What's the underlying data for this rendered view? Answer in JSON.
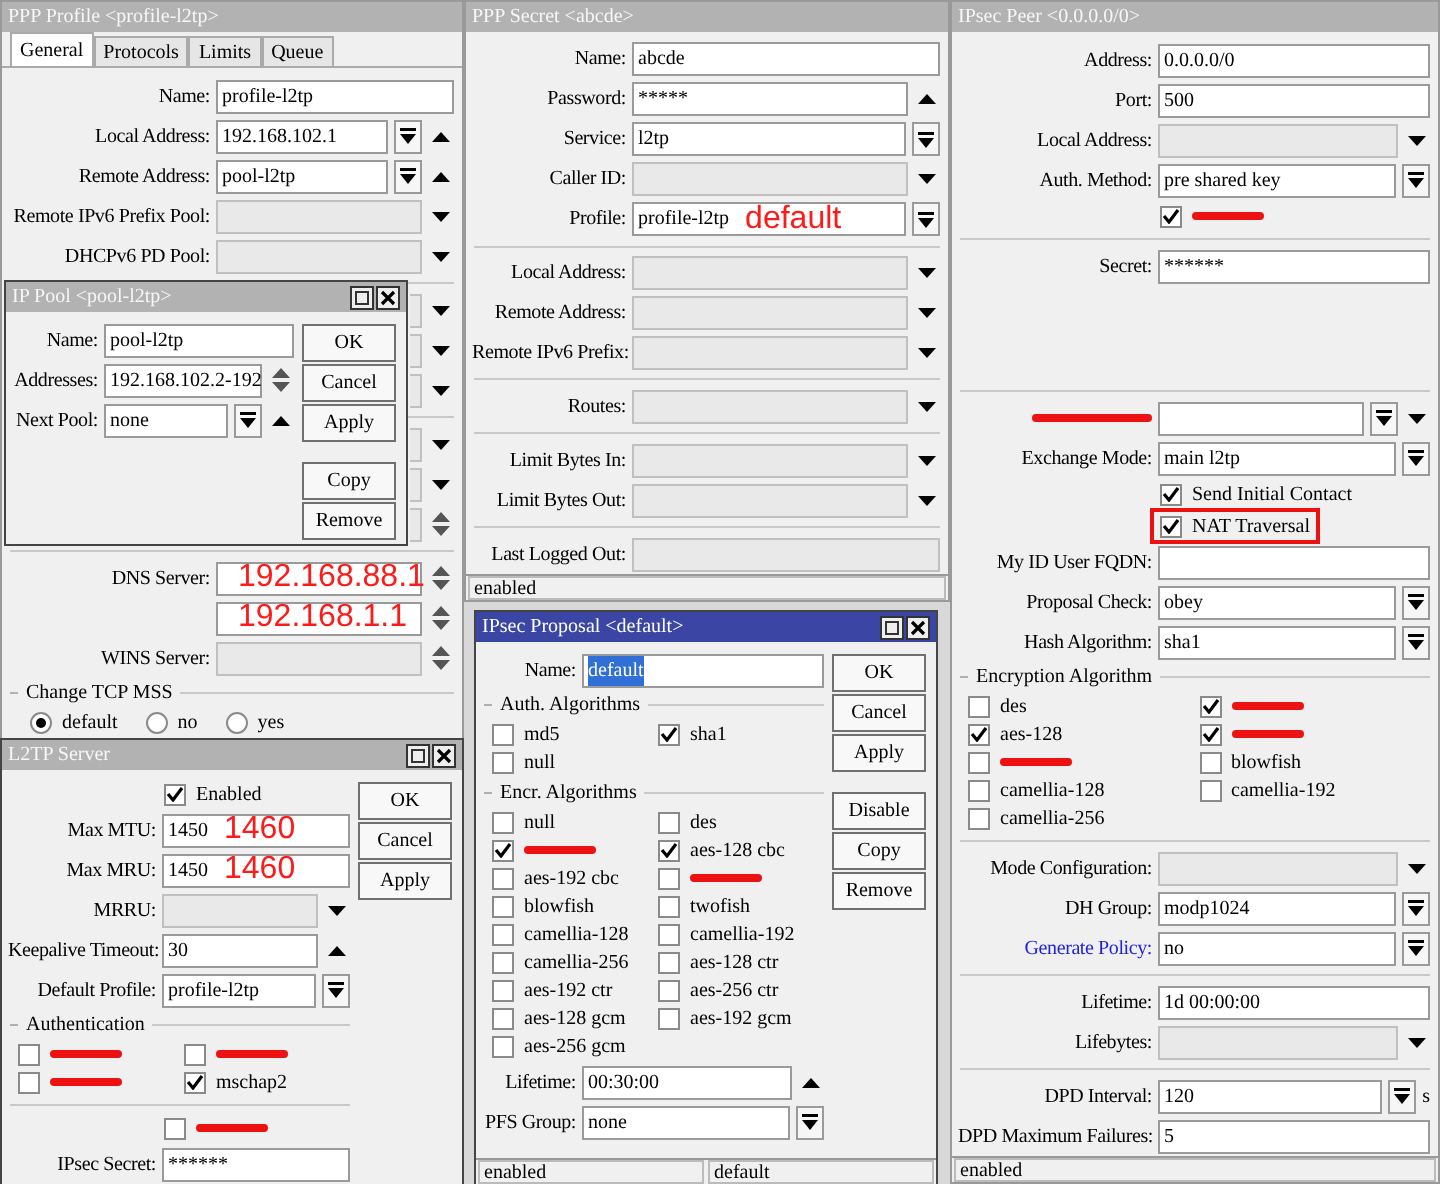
{
  "windows": [
    {
      "title": "PPP Profile <profile-l2tp>",
      "active": false,
      "tabs": [
        {
          "label": "General",
          "selected": true
        },
        {
          "label": "Protocols",
          "selected": false
        },
        {
          "label": "Limits",
          "selected": false
        },
        {
          "label": "Queue",
          "selected": false
        }
      ],
      "rows": [
        {
          "kind": "field",
          "label": "Name:",
          "value": "profile-l2tp",
          "disabled": false
        },
        {
          "kind": "field",
          "label": "Local Address:",
          "value": "192.168.102.1",
          "disabled": false,
          "controls": [
            {
              "kind": "combo"
            },
            {
              "kind": "up"
            }
          ]
        },
        {
          "kind": "field",
          "label": "Remote Address:",
          "value": "pool-l2tp",
          "disabled": false,
          "controls": [
            {
              "kind": "combo"
            },
            {
              "kind": "up"
            }
          ]
        },
        {
          "kind": "field",
          "label": "Remote IPv6 Prefix Pool:",
          "disabled": true,
          "controls": [
            {
              "kind": "down"
            }
          ]
        },
        {
          "kind": "field",
          "label": "DHCPv6 PD Pool:",
          "disabled": true,
          "controls": [
            {
              "kind": "down"
            }
          ]
        },
        {
          "kind": "divider"
        },
        {
          "kind": "stub",
          "controls": [
            {
              "kind": "down"
            }
          ]
        },
        {
          "kind": "stub",
          "controls": [
            {
              "kind": "down"
            }
          ]
        },
        {
          "kind": "stub",
          "controls": [
            {
              "kind": "down"
            }
          ]
        },
        {
          "kind": "divider"
        },
        {
          "kind": "stub",
          "controls": [
            {
              "kind": "down"
            }
          ]
        },
        {
          "kind": "stub",
          "controls": [
            {
              "kind": "down"
            }
          ]
        },
        {
          "kind": "stub",
          "controls": [
            {
              "kind": "updown"
            }
          ]
        },
        {
          "kind": "divider"
        },
        {
          "kind": "field",
          "label": "DNS Server:",
          "disabled": false,
          "note": "192.168.88.1",
          "controls": [
            {
              "kind": "updown"
            }
          ]
        },
        {
          "kind": "field",
          "disabled": false,
          "note": "192.168.1.1",
          "controls": [
            {
              "kind": "updown"
            }
          ]
        },
        {
          "kind": "field",
          "label": "WINS Server:",
          "disabled": true,
          "controls": [
            {
              "kind": "updown"
            }
          ]
        },
        {
          "kind": "section",
          "label": "Change TCP MSS"
        },
        {
          "kind": "radios",
          "options": [
            {
              "label": "default",
              "selected": true
            },
            {
              "label": "no",
              "selected": false
            },
            {
              "label": "yes",
              "selected": false
            }
          ]
        }
      ]
    },
    {
      "title": "IP Pool <pool-l2tp>",
      "active": false,
      "window_buttons": true,
      "rows": [
        {
          "kind": "field",
          "label": "Name:",
          "value": "pool-l2tp",
          "disabled": false
        },
        {
          "kind": "field",
          "label": "Addresses:",
          "value": "192.168.102.2-192",
          "disabled": false,
          "controls": [
            {
              "kind": "updown"
            }
          ]
        },
        {
          "kind": "field",
          "label": "Next Pool:",
          "value": "none",
          "disabled": false,
          "controls": [
            {
              "kind": "combo"
            },
            {
              "kind": "up"
            }
          ]
        }
      ],
      "buttons": [
        [
          "OK",
          "Cancel",
          "Apply"
        ],
        [
          "Copy",
          "Remove"
        ]
      ]
    },
    {
      "title": "L2TP Server",
      "active": false,
      "window_buttons": true,
      "rows": [
        {
          "kind": "check",
          "label": "Enabled",
          "checked": true
        },
        {
          "kind": "field",
          "label": "Max MTU:",
          "value": "1450",
          "note": "1460",
          "disabled": false
        },
        {
          "kind": "field",
          "label": "Max MRU:",
          "value": "1450",
          "note": "1460",
          "disabled": false
        },
        {
          "kind": "field",
          "label": "MRRU:",
          "disabled": true,
          "controls": [
            {
              "kind": "down"
            }
          ]
        },
        {
          "kind": "field",
          "label": "Keepalive Timeout:",
          "value": "30",
          "disabled": false,
          "controls": [
            {
              "kind": "up"
            }
          ]
        },
        {
          "kind": "field",
          "label": "Default Profile:",
          "value": "profile-l2tp",
          "disabled": false,
          "controls": [
            {
              "kind": "combo"
            }
          ]
        },
        {
          "kind": "section",
          "label": "Authentication"
        },
        {
          "kind": "checkgrid",
          "items": [
            {
              "checked": false,
              "redacted": true
            },
            {
              "checked": false,
              "redacted": true
            },
            {
              "checked": false,
              "redacted": true
            },
            {
              "label": "mschap2",
              "checked": true,
              "redacted": false
            }
          ]
        },
        {
          "kind": "divider"
        },
        {
          "kind": "check",
          "checked": false,
          "redacted": true
        },
        {
          "kind": "field",
          "label": "IPsec Secret:",
          "value": "******",
          "disabled": false
        }
      ],
      "buttons": [
        [
          "OK",
          "Cancel",
          "Apply"
        ]
      ]
    },
    {
      "title": "PPP Secret <abcde>",
      "active": false,
      "rows": [
        {
          "kind": "field",
          "label": "Name:",
          "value": "abcde",
          "disabled": false
        },
        {
          "kind": "field",
          "label": "Password:",
          "value": "*****",
          "disabled": false,
          "controls": [
            {
              "kind": "up"
            }
          ]
        },
        {
          "kind": "field",
          "label": "Service:",
          "value": "l2tp",
          "disabled": false,
          "controls": [
            {
              "kind": "combo"
            }
          ]
        },
        {
          "kind": "field",
          "label": "Caller ID:",
          "disabled": true,
          "controls": [
            {
              "kind": "down"
            }
          ]
        },
        {
          "kind": "field",
          "label": "Profile:",
          "value": "profile-l2tp",
          "note": "default",
          "disabled": false,
          "controls": [
            {
              "kind": "combo"
            }
          ]
        },
        {
          "kind": "divider"
        },
        {
          "kind": "field",
          "label": "Local Address:",
          "disabled": true,
          "controls": [
            {
              "kind": "down"
            }
          ]
        },
        {
          "kind": "field",
          "label": "Remote Address:",
          "disabled": true,
          "controls": [
            {
              "kind": "down"
            }
          ]
        },
        {
          "kind": "field",
          "label": "Remote IPv6 Prefix:",
          "disabled": true,
          "controls": [
            {
              "kind": "down"
            }
          ]
        },
        {
          "kind": "divider"
        },
        {
          "kind": "field",
          "label": "Routes:",
          "disabled": true,
          "controls": [
            {
              "kind": "down"
            }
          ]
        },
        {
          "kind": "divider"
        },
        {
          "kind": "field",
          "label": "Limit Bytes In:",
          "disabled": true,
          "controls": [
            {
              "kind": "down"
            }
          ]
        },
        {
          "kind": "field",
          "label": "Limit Bytes Out:",
          "disabled": true,
          "controls": [
            {
              "kind": "down"
            }
          ]
        },
        {
          "kind": "divider"
        },
        {
          "kind": "field",
          "label": "Last Logged Out:",
          "disabled": true
        }
      ],
      "status": [
        "enabled"
      ]
    },
    {
      "title": "IPsec Proposal <default>",
      "active": true,
      "window_buttons": true,
      "rows": [
        {
          "kind": "field",
          "label": "Name:",
          "value": "default",
          "highlighted": true,
          "disabled": false
        },
        {
          "kind": "section",
          "label": "Auth. Algorithms"
        },
        {
          "kind": "checkgrid",
          "items": [
            {
              "label": "md5",
              "checked": false,
              "redacted": false
            },
            {
              "label": "sha1",
              "checked": true,
              "redacted": false
            },
            {
              "label": "null",
              "checked": false,
              "redacted": false
            }
          ]
        },
        {
          "kind": "section",
          "label": "Encr. Algorithms"
        },
        {
          "kind": "checkgrid",
          "items": [
            {
              "label": "null",
              "checked": false,
              "redacted": false
            },
            {
              "label": "des",
              "checked": false,
              "redacted": false
            },
            {
              "checked": true,
              "redacted": true
            },
            {
              "label": "aes-128 cbc",
              "checked": true,
              "redacted": false
            },
            {
              "label": "aes-192 cbc",
              "checked": false,
              "redacted": false
            },
            {
              "checked": false,
              "redacted": true
            },
            {
              "label": "blowfish",
              "checked": false,
              "redacted": false
            },
            {
              "label": "twofish",
              "checked": false,
              "redacted": false
            },
            {
              "label": "camellia-128",
              "checked": false,
              "redacted": false
            },
            {
              "label": "camellia-192",
              "checked": false,
              "redacted": false
            },
            {
              "label": "camellia-256",
              "checked": false,
              "redacted": false
            },
            {
              "label": "aes-128 ctr",
              "checked": false,
              "redacted": false
            },
            {
              "label": "aes-192 ctr",
              "checked": false,
              "redacted": false
            },
            {
              "label": "aes-256 ctr",
              "checked": false,
              "redacted": false
            },
            {
              "label": "aes-128 gcm",
              "checked": false,
              "redacted": false
            },
            {
              "label": "aes-192 gcm",
              "checked": false,
              "redacted": false
            },
            {
              "label": "aes-256 gcm",
              "checked": false,
              "redacted": false
            }
          ]
        },
        {
          "kind": "field",
          "label": "Lifetime:",
          "value": "00:30:00",
          "disabled": false,
          "controls": [
            {
              "kind": "up"
            }
          ]
        },
        {
          "kind": "field",
          "label": "PFS Group:",
          "value": "none",
          "disabled": false,
          "controls": [
            {
              "kind": "combo"
            }
          ]
        }
      ],
      "buttons": [
        [
          "OK",
          "Cancel",
          "Apply"
        ],
        [
          "Disable",
          "Copy",
          "Remove"
        ]
      ],
      "status": [
        "enabled",
        "default"
      ]
    },
    {
      "title": "IPsec Peer <0.0.0.0/0>",
      "active": false,
      "rows": [
        {
          "kind": "field",
          "label": "Address:",
          "value": "0.0.0.0/0",
          "disabled": false
        },
        {
          "kind": "field",
          "label": "Port:",
          "value": "500",
          "disabled": false
        },
        {
          "kind": "field",
          "label": "Local Address:",
          "disabled": true,
          "controls": [
            {
              "kind": "down"
            }
          ]
        },
        {
          "kind": "field",
          "label": "Auth. Method:",
          "value": "pre shared key",
          "disabled": false,
          "controls": [
            {
              "kind": "combo"
            }
          ]
        },
        {
          "kind": "check",
          "checked": true,
          "redacted": true
        },
        {
          "kind": "divider"
        },
        {
          "kind": "field",
          "label": "Secret:",
          "value": "******",
          "disabled": false
        },
        {
          "kind": "gap"
        },
        {
          "kind": "divider"
        },
        {
          "kind": "field",
          "disabled": false,
          "redacted": true,
          "controls": [
            {
              "kind": "combo"
            },
            {
              "kind": "down"
            }
          ]
        },
        {
          "kind": "field",
          "label": "Exchange Mode:",
          "value": "main l2tp",
          "disabled": false,
          "controls": [
            {
              "kind": "combo"
            }
          ]
        },
        {
          "kind": "check",
          "label": "Send Initial Contact",
          "checked": true
        },
        {
          "kind": "check",
          "label": "NAT Traversal",
          "checked": true,
          "outlined": true
        },
        {
          "kind": "field",
          "label": "My ID User FQDN:",
          "disabled": false
        },
        {
          "kind": "field",
          "label": "Proposal Check:",
          "value": "obey",
          "disabled": false,
          "controls": [
            {
              "kind": "combo"
            }
          ]
        },
        {
          "kind": "field",
          "label": "Hash Algorithm:",
          "value": "sha1",
          "disabled": false,
          "controls": [
            {
              "kind": "combo"
            }
          ]
        },
        {
          "kind": "section",
          "label": "Encryption Algorithm"
        },
        {
          "kind": "checkgrid",
          "items": [
            {
              "label": "des",
              "checked": false,
              "redacted": false
            },
            {
              "checked": true,
              "redacted": true
            },
            {
              "label": "aes-128",
              "checked": true,
              "redacted": false
            },
            {
              "checked": true,
              "redacted": true
            },
            {
              "checked": false,
              "redacted": true
            },
            {
              "label": "blowfish",
              "checked": false,
              "redacted": false
            },
            {
              "label": "camellia-128",
              "checked": false,
              "redacted": false
            },
            {
              "label": "camellia-192",
              "checked": false,
              "redacted": false
            },
            {
              "label": "camellia-256",
              "checked": false,
              "redacted": false
            }
          ]
        },
        {
          "kind": "divider"
        },
        {
          "kind": "field",
          "label": "Mode Configuration:",
          "disabled": true,
          "controls": [
            {
              "kind": "down"
            }
          ]
        },
        {
          "kind": "field",
          "label": "DH Group:",
          "value": "modp1024",
          "disabled": false,
          "controls": [
            {
              "kind": "combo"
            }
          ]
        },
        {
          "kind": "field",
          "label": "Generate Policy:",
          "link": true,
          "value": "no",
          "disabled": false,
          "controls": [
            {
              "kind": "combo"
            }
          ]
        },
        {
          "kind": "divider"
        },
        {
          "kind": "field",
          "label": "Lifetime:",
          "value": "1d 00:00:00",
          "disabled": false
        },
        {
          "kind": "field",
          "label": "Lifebytes:",
          "disabled": true,
          "controls": [
            {
              "kind": "down"
            }
          ]
        },
        {
          "kind": "divider"
        },
        {
          "kind": "field",
          "label": "DPD Interval:",
          "value": "120",
          "disabled": false,
          "controls": [
            {
              "kind": "combo"
            }
          ],
          "suffix": "s"
        },
        {
          "kind": "field",
          "label": "DPD Maximum Failures:",
          "value": "5",
          "disabled": false
        }
      ],
      "status": [
        "enabled"
      ]
    }
  ]
}
